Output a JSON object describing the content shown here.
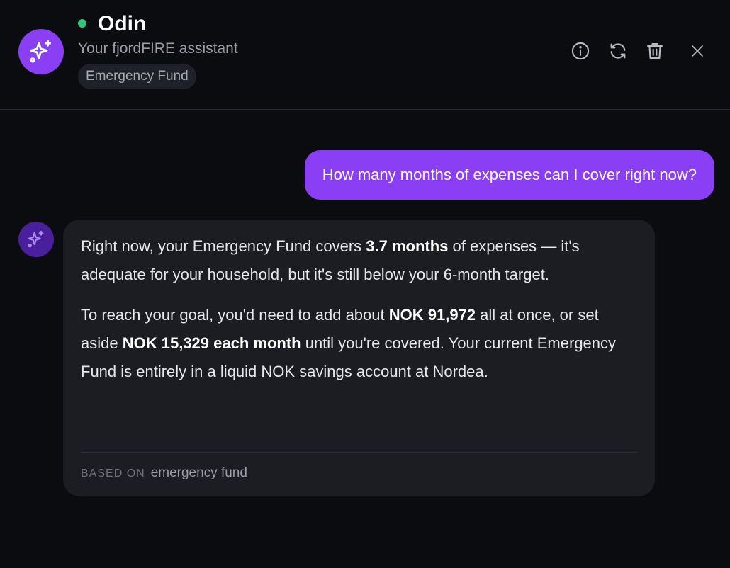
{
  "header": {
    "name": "Odin",
    "subtitle": "Your fjordFIRE assistant",
    "context_chip": "Emergency Fund",
    "status_color": "#34c37a",
    "accent_color": "#8b3ff5",
    "actions": [
      {
        "icon": "info-icon"
      },
      {
        "icon": "refresh-icon"
      },
      {
        "icon": "trash-icon"
      },
      {
        "icon": "close-icon"
      }
    ]
  },
  "conversation": {
    "user_message": "How many months of expenses can I cover right now?",
    "assistant_message": {
      "p1": {
        "t1": "Right now, your Emergency Fund covers ",
        "b1": "3.7 months",
        "t2": " of expenses — it's adequate for your household, but it's still below your 6-month target."
      },
      "p2": {
        "t1": "To reach your goal, you'd need to add about ",
        "b1": "NOK 91,972",
        "t2": " all at once, or set aside ",
        "b2": "NOK 15,329 each month",
        "t3": " until you're covered. Your current Emergency Fund is entirely in a liquid NOK savings account at Nordea."
      },
      "source_label": "BASED ON",
      "source_value": "emergency fund"
    }
  }
}
